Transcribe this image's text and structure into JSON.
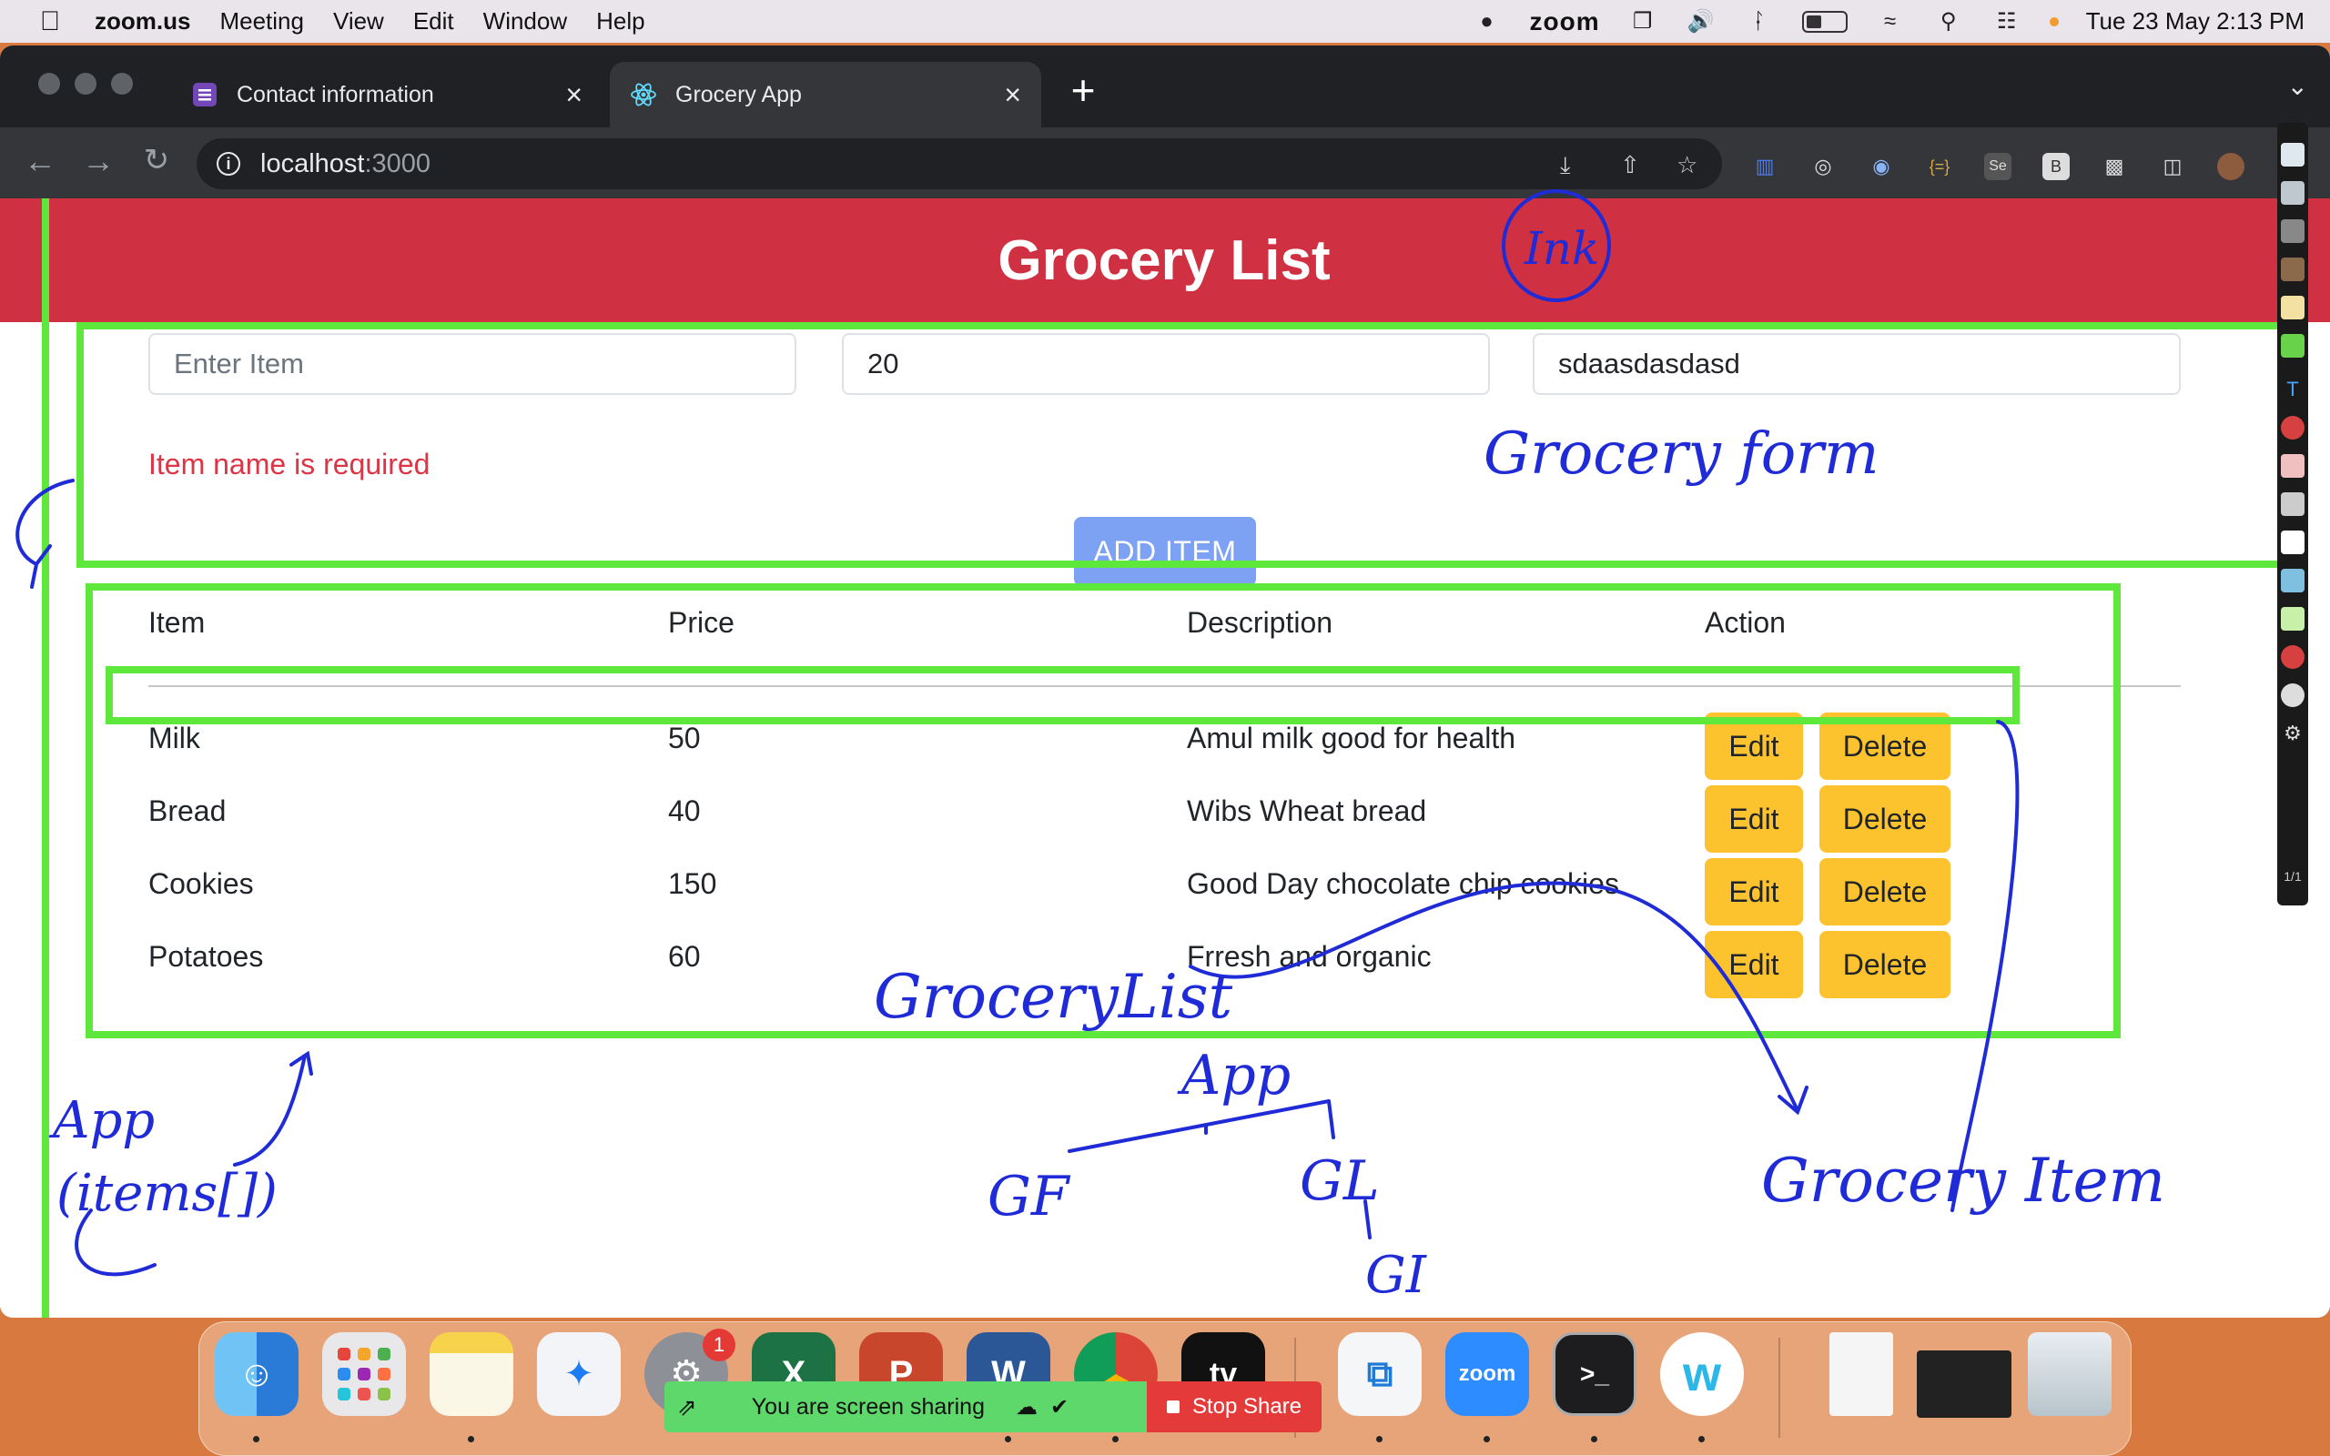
{
  "menubar": {
    "app": "zoom.us",
    "menus": [
      "Meeting",
      "View",
      "Edit",
      "Window",
      "Help"
    ],
    "zoom_label": "zoom",
    "datetime": "Tue 23 May  2:13 PM"
  },
  "tabs": [
    {
      "label": "Contact information",
      "active": false
    },
    {
      "label": "Grocery App",
      "active": true
    }
  ],
  "omnibox": {
    "host": "localhost",
    "port": ":3000"
  },
  "app": {
    "title": "Grocery List",
    "form": {
      "item_placeholder": "Enter Item",
      "item_value": "",
      "price_value": "20",
      "description_value": "sdaasdasdasd",
      "error": "Item name is required",
      "add_label": "ADD ITEM"
    },
    "table": {
      "headers": [
        "Item",
        "Price",
        "Description",
        "Action"
      ],
      "rows": [
        {
          "item": "Milk",
          "price": "50",
          "description": "Amul milk good for health"
        },
        {
          "item": "Bread",
          "price": "40",
          "description": "Wibs Wheat bread"
        },
        {
          "item": "Cookies",
          "price": "150",
          "description": "Good Day chocolate chip cookies"
        },
        {
          "item": "Potatoes",
          "price": "60",
          "description": "Frresh and organic"
        }
      ],
      "edit_label": "Edit",
      "delete_label": "Delete"
    }
  },
  "annotations": {
    "form_label": "Grocery form",
    "list_label": "GroceryList",
    "item_label": "Grocery Item",
    "app_tree": [
      "App",
      "GF",
      "GL",
      "GI"
    ],
    "side_note": [
      "App",
      "(items[])"
    ],
    "scribble": "Ink",
    "toolbar_page": "1/1",
    "highlight_color": "#5ee83c",
    "ink_color": "#1f2bd6"
  },
  "screen_share": {
    "status": "You are screen sharing",
    "stop_label": "Stop Share"
  },
  "dock": {
    "apps": [
      "finder",
      "launchpad",
      "notes",
      "safari",
      "system-settings",
      "excel",
      "powerpoint",
      "word",
      "chrome",
      "apple-tv",
      "vscode",
      "zoom",
      "terminal",
      "webex",
      "document",
      "vscode-window",
      "trash"
    ],
    "notification_badge": "1",
    "zoom_label": "zoom",
    "tv_label": "tv",
    "terminal_label": ">_"
  }
}
